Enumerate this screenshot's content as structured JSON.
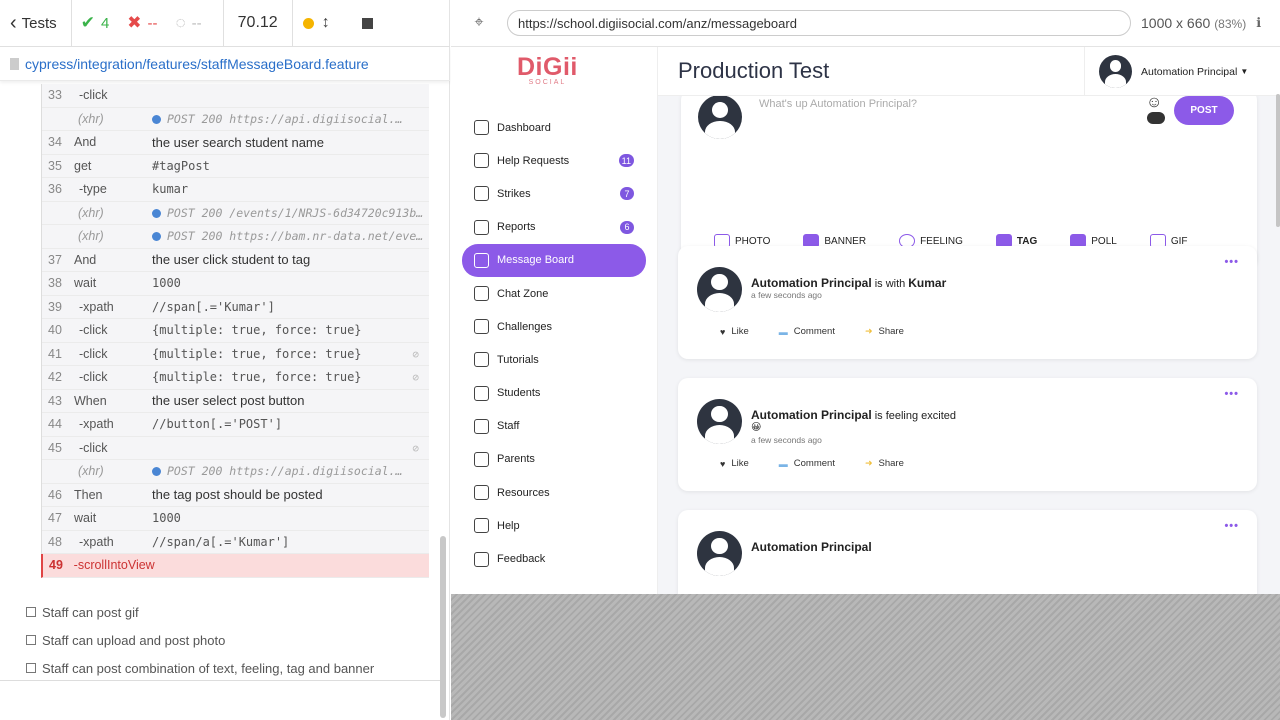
{
  "runner": {
    "tests_label": "Tests",
    "passed": "4",
    "failed": "--",
    "pending": "--",
    "duration": "70.12",
    "spec_path": "cypress/integration/features/staffMessageBoard.feature"
  },
  "commands": [
    {
      "num": "33",
      "name": "-click",
      "msg": "",
      "kind": "child"
    },
    {
      "num": "",
      "name": "(xhr)",
      "msg": "POST 200 https://api.digiisocial.…",
      "kind": "xhr"
    },
    {
      "num": "34",
      "name": "And",
      "msg": "the user search student name",
      "kind": "step"
    },
    {
      "num": "35",
      "name": "get",
      "msg": "#tagPost",
      "kind": "cmd"
    },
    {
      "num": "36",
      "name": "-type",
      "msg": "kumar",
      "kind": "child"
    },
    {
      "num": "",
      "name": "(xhr)",
      "msg": "POST 200 /events/1/NRJS-6d34720c913b2cab…",
      "kind": "xhr"
    },
    {
      "num": "",
      "name": "(xhr)",
      "msg": "POST 200 https://bam.nr-data.net/events/…",
      "kind": "xhr"
    },
    {
      "num": "37",
      "name": "And",
      "msg": "the user click student to tag",
      "kind": "step"
    },
    {
      "num": "38",
      "name": "wait",
      "msg": "1000",
      "kind": "cmd"
    },
    {
      "num": "39",
      "name": "-xpath",
      "msg": "//span[.='Kumar']",
      "kind": "child"
    },
    {
      "num": "40",
      "name": "-click",
      "msg": "{multiple: true, force: true}",
      "kind": "child"
    },
    {
      "num": "41",
      "name": "-click",
      "msg": "{multiple: true, force: true}",
      "kind": "child",
      "eye": true
    },
    {
      "num": "42",
      "name": "-click",
      "msg": "{multiple: true, force: true}",
      "kind": "child",
      "eye": true
    },
    {
      "num": "43",
      "name": "When",
      "msg": "the user select post button",
      "kind": "step"
    },
    {
      "num": "44",
      "name": "-xpath",
      "msg": "//button[.='POST']",
      "kind": "child"
    },
    {
      "num": "45",
      "name": "-click",
      "msg": "",
      "kind": "child",
      "eye": true
    },
    {
      "num": "",
      "name": "(xhr)",
      "msg": "POST 200 https://api.digiisocial.…",
      "kind": "xhr"
    },
    {
      "num": "46",
      "name": "Then",
      "msg": "the tag post should be posted",
      "kind": "step"
    },
    {
      "num": "47",
      "name": "wait",
      "msg": "1000",
      "kind": "cmd"
    },
    {
      "num": "48",
      "name": "-xpath",
      "msg": "//span/a[.='Kumar']",
      "kind": "child"
    },
    {
      "num": "49",
      "name": "-scrollIntoView",
      "msg": "",
      "kind": "failed"
    }
  ],
  "pending_tests": [
    "Staff can post gif",
    "Staff can upload and post photo",
    "Staff can post combination of text, feeling, tag and banner"
  ],
  "aut_header": {
    "url": "https://school.digiisocial.com/anz/messageboard",
    "viewport": "1000 x 660",
    "scale": "(83%)"
  },
  "app": {
    "logo_main": "DiGii",
    "logo_sub": "SOCIAL",
    "page_title": "Production Test",
    "user_name": "Automation Principal",
    "nav": [
      {
        "label": "Dashboard",
        "icon": "dashboard-icon",
        "badge": ""
      },
      {
        "label": "Help Requests",
        "icon": "help-requests-icon",
        "badge": "11"
      },
      {
        "label": "Strikes",
        "icon": "strikes-icon",
        "badge": "7"
      },
      {
        "label": "Reports",
        "icon": "reports-icon",
        "badge": "6"
      },
      {
        "label": "Message Board",
        "icon": "message-board-icon",
        "badge": "",
        "active": true
      },
      {
        "label": "Chat Zone",
        "icon": "chat-icon",
        "badge": ""
      },
      {
        "label": "Challenges",
        "icon": "challenges-icon",
        "badge": ""
      },
      {
        "label": "Tutorials",
        "icon": "tutorials-icon",
        "badge": ""
      },
      {
        "label": "Students",
        "icon": "students-icon",
        "badge": ""
      },
      {
        "label": "Staff",
        "icon": "staff-icon",
        "badge": ""
      },
      {
        "label": "Parents",
        "icon": "parents-icon",
        "badge": ""
      },
      {
        "label": "Resources",
        "icon": "resources-icon",
        "badge": ""
      },
      {
        "label": "Help",
        "icon": "help-icon",
        "badge": ""
      },
      {
        "label": "Feedback",
        "icon": "feedback-icon",
        "badge": ""
      }
    ],
    "composer": {
      "placeholder": "What's up Automation Principal?",
      "post_label": "POST",
      "tools": [
        "PHOTO",
        "BANNER",
        "FEELING",
        "TAG",
        "POLL",
        "GIF"
      ]
    },
    "posts": [
      {
        "author": "Automation Principal",
        "connector": "is with",
        "target": "Kumar",
        "time": "a few seconds ago",
        "emoji": ""
      },
      {
        "author": "Automation Principal",
        "connector": "is feeling excited",
        "target": "",
        "time": "a few seconds ago",
        "emoji": "😀"
      },
      {
        "author": "Automation Principal",
        "connector": "",
        "target": "",
        "time": "",
        "emoji": ""
      }
    ],
    "post_actions": [
      "Like",
      "Comment",
      "Share"
    ]
  },
  "colors": {
    "accent": "#8c5ae8",
    "pass": "#3bb34a",
    "fail": "#e54a4a",
    "link": "#2a6fc9"
  }
}
